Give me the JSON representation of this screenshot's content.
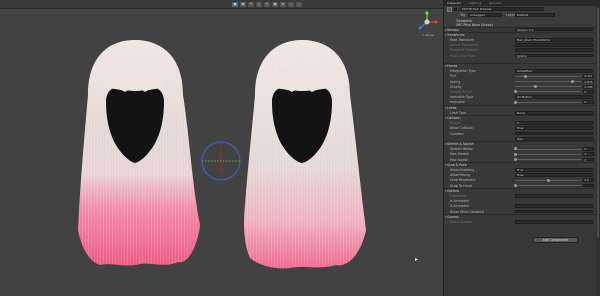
{
  "scene": {
    "toolbar_icons": [
      {
        "name": "gizmos-icon"
      },
      {
        "name": "grid-icon"
      },
      {
        "name": "lighting-icon"
      },
      {
        "name": "audio-icon"
      },
      {
        "name": "effects-icon"
      },
      {
        "name": "camera-icon"
      },
      {
        "name": "layers-icon"
      },
      {
        "name": "search-icon"
      },
      {
        "name": "more-icon"
      }
    ],
    "gizmo_label": "< Persp",
    "colors": {
      "background": "#424242",
      "hair_base": "#e4d9d6",
      "hair_tips": "#ee6a8f",
      "gizmo_ring": "#4a5ca8",
      "gizmo_x": "#d64545",
      "gizmo_y": "#7bd64a"
    }
  },
  "inspector": {
    "tabs": [
      "Inspector",
      "Lighting",
      "Services"
    ],
    "object": {
      "name": "Mi7HR Hair Preview",
      "tag_label": "Tag",
      "tag_value": "Untagged",
      "layer_label": "Layer",
      "layer_value": "Default"
    },
    "components": [
      {
        "label": "Transform"
      },
      {
        "label": "VRC Phys Bone (Script)"
      }
    ],
    "rows": [
      {
        "type": "header",
        "label": "Version",
        "value": "Version 1.1"
      },
      {
        "type": "header",
        "label": "Transforms"
      },
      {
        "type": "field",
        "label": "Root Transform",
        "value": "Hair_Root (Transform)"
      },
      {
        "type": "field",
        "label": "Ignore Transforms",
        "value": "",
        "dim": true
      },
      {
        "type": "field",
        "label": "Endpoint Position",
        "value": "",
        "dim": true
      },
      {
        "type": "field",
        "label": "Multi Child Type",
        "value": "Ignore",
        "dim": true
      },
      {
        "type": "blank"
      },
      {
        "type": "header",
        "label": "Forces"
      },
      {
        "type": "field",
        "label": "Integration Type",
        "value": "Simplified"
      },
      {
        "type": "slider",
        "label": "Pull",
        "value": "0.157",
        "frac": 0.157
      },
      {
        "type": "slider",
        "label": "Spring",
        "value": "0.876",
        "frac": 0.876
      },
      {
        "type": "slider",
        "label": "Gravity",
        "value": "0.306",
        "frac": 0.306
      },
      {
        "type": "slider",
        "label": "Gravity Falloff",
        "value": "0",
        "frac": 0.0,
        "dim": true
      },
      {
        "type": "field",
        "label": "Immobile Type",
        "value": "All Motion"
      },
      {
        "type": "slider",
        "label": "Immobile",
        "value": "0",
        "frac": 0.0
      },
      {
        "type": "header",
        "label": "Limits"
      },
      {
        "type": "field",
        "label": "Limit Type",
        "value": "None"
      },
      {
        "type": "header",
        "label": "Collision"
      },
      {
        "type": "field",
        "label": "Radius",
        "value": "0",
        "dim": true
      },
      {
        "type": "field",
        "label": "Allow Collision",
        "value": "True"
      },
      {
        "type": "field",
        "label": "Colliders",
        "value": ""
      },
      {
        "type": "field",
        "label": "",
        "value": "Size",
        "dim": true
      },
      {
        "type": "header",
        "label": "Stretch & Squish"
      },
      {
        "type": "slider",
        "label": "Stretch Motion",
        "value": "0",
        "frac": 0.0
      },
      {
        "type": "slider",
        "label": "Max Stretch",
        "value": "0",
        "frac": 0.0
      },
      {
        "type": "slider",
        "label": "Max Squish",
        "value": "0",
        "frac": 0.0
      },
      {
        "type": "header",
        "label": "Grab & Pose"
      },
      {
        "type": "field",
        "label": "Allow Grabbing",
        "value": "True"
      },
      {
        "type": "field",
        "label": "Allow Posing",
        "value": "True"
      },
      {
        "type": "slider",
        "label": "Grab Movement",
        "value": "0.5",
        "frac": 0.5
      },
      {
        "type": "slider",
        "label": "Snap To Hand",
        "value": "",
        "frac": 0.0
      },
      {
        "type": "header",
        "label": "Options"
      },
      {
        "type": "field",
        "label": "Parameter",
        "value": "",
        "dim": true
      },
      {
        "type": "note",
        "label": "Is Animated"
      },
      {
        "type": "field",
        "label": "Is Animated",
        "value": ""
      },
      {
        "type": "field",
        "label": "Reset When Disabled",
        "value": ""
      },
      {
        "type": "header",
        "label": "Gizmos"
      },
      {
        "type": "field",
        "label": "Show Gizmos",
        "value": "",
        "dim": true
      }
    ],
    "add_component_label": "Add Component"
  }
}
